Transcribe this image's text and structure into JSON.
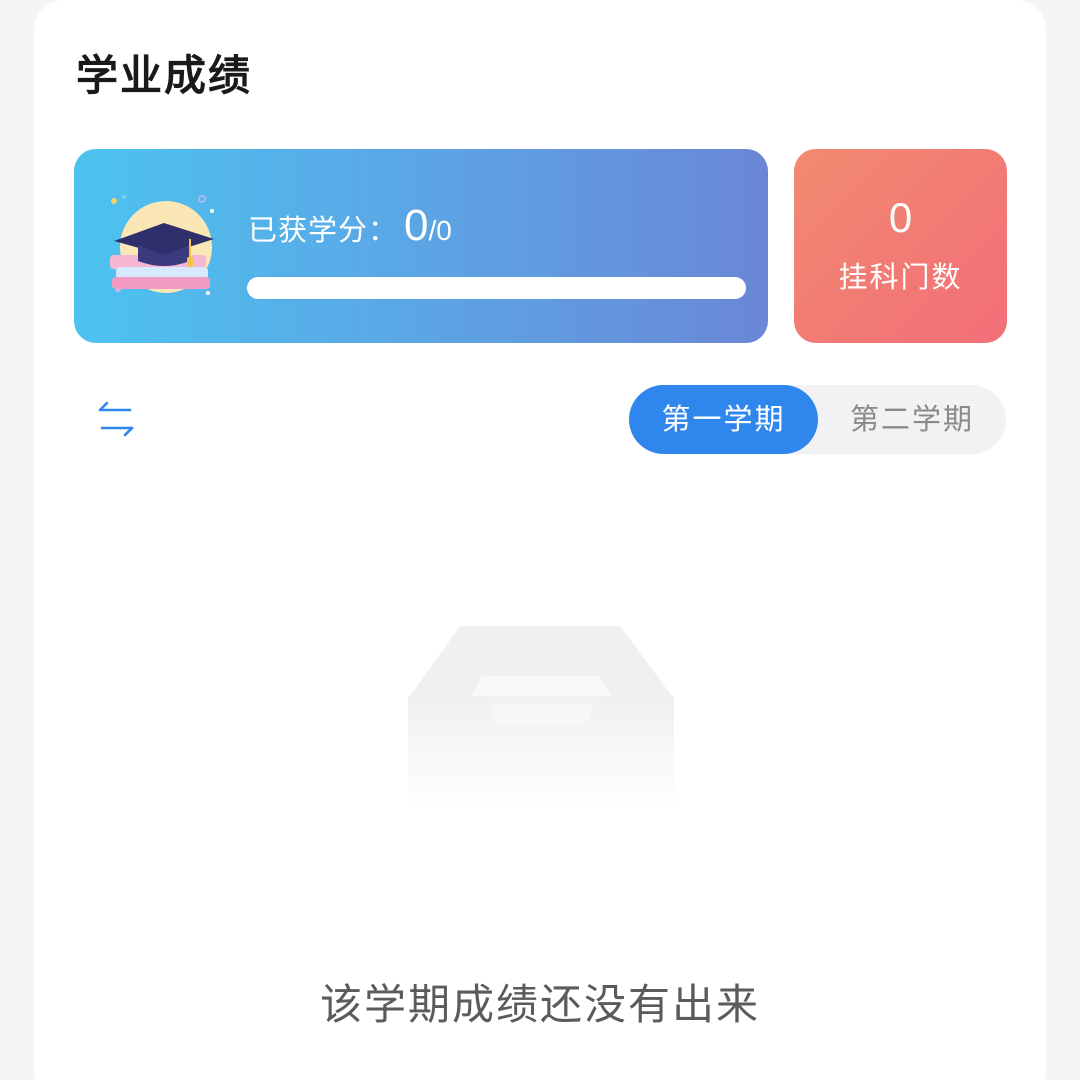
{
  "header": {
    "title": "学业成绩"
  },
  "credits": {
    "label": "已获学分：",
    "earned": "0",
    "separator": "/",
    "total": "0",
    "progress_fraction": 0,
    "icon": "graduation-cap-icon"
  },
  "failed": {
    "count": "0",
    "label": "挂科门数"
  },
  "term_switch": {
    "tabs": [
      {
        "label": "第一学期",
        "selected": true
      },
      {
        "label": "第二学期",
        "selected": false
      }
    ],
    "swap_icon": "swap-arrows-icon"
  },
  "empty_state": {
    "message": "该学期成绩还没有出来",
    "icon": "empty-tray-icon"
  },
  "colors": {
    "accent": "#2f86ec",
    "credit_gradient_start": "#4cc3ef",
    "credit_gradient_end": "#6a87d6",
    "fail_gradient_start": "#f28a70",
    "fail_gradient_end": "#f26e78"
  }
}
